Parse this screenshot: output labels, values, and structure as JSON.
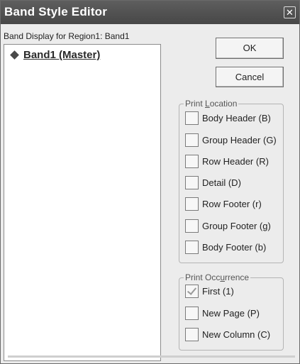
{
  "window": {
    "title": "Band Style Editor",
    "close_glyph": "✕"
  },
  "left": {
    "label": "Band Display for Region1: Band1",
    "tree_item": "Band1 (Master)"
  },
  "buttons": {
    "ok": "OK",
    "cancel": "Cancel"
  },
  "print_location": {
    "legend_pre": "Print ",
    "legend_ul": "L",
    "legend_post": "ocation",
    "options": [
      {
        "label": "Body Header (B)",
        "checked": false
      },
      {
        "label": "Group Header (G)",
        "checked": false
      },
      {
        "label": "Row Header (R)",
        "checked": false
      },
      {
        "label": "Detail (D)",
        "checked": false
      },
      {
        "label": "Row Footer (r)",
        "checked": false
      },
      {
        "label": "Group Footer (g)",
        "checked": false
      },
      {
        "label": "Body Footer (b)",
        "checked": false
      }
    ]
  },
  "print_occurrence": {
    "legend_pre": "Print Occ",
    "legend_ul": "u",
    "legend_post": "rrence",
    "options": [
      {
        "label": "First (1)",
        "checked": true
      },
      {
        "label": "New Page (P)",
        "checked": false
      },
      {
        "label": "New Column (C)",
        "checked": false
      }
    ]
  },
  "colors": {
    "titlebar": "#4f4f4f",
    "dialog_bg": "#ececec",
    "tree_bg": "#ffffff"
  },
  "icons": {
    "tree_item": "diamond-icon",
    "checked": "checkmark-icon"
  }
}
